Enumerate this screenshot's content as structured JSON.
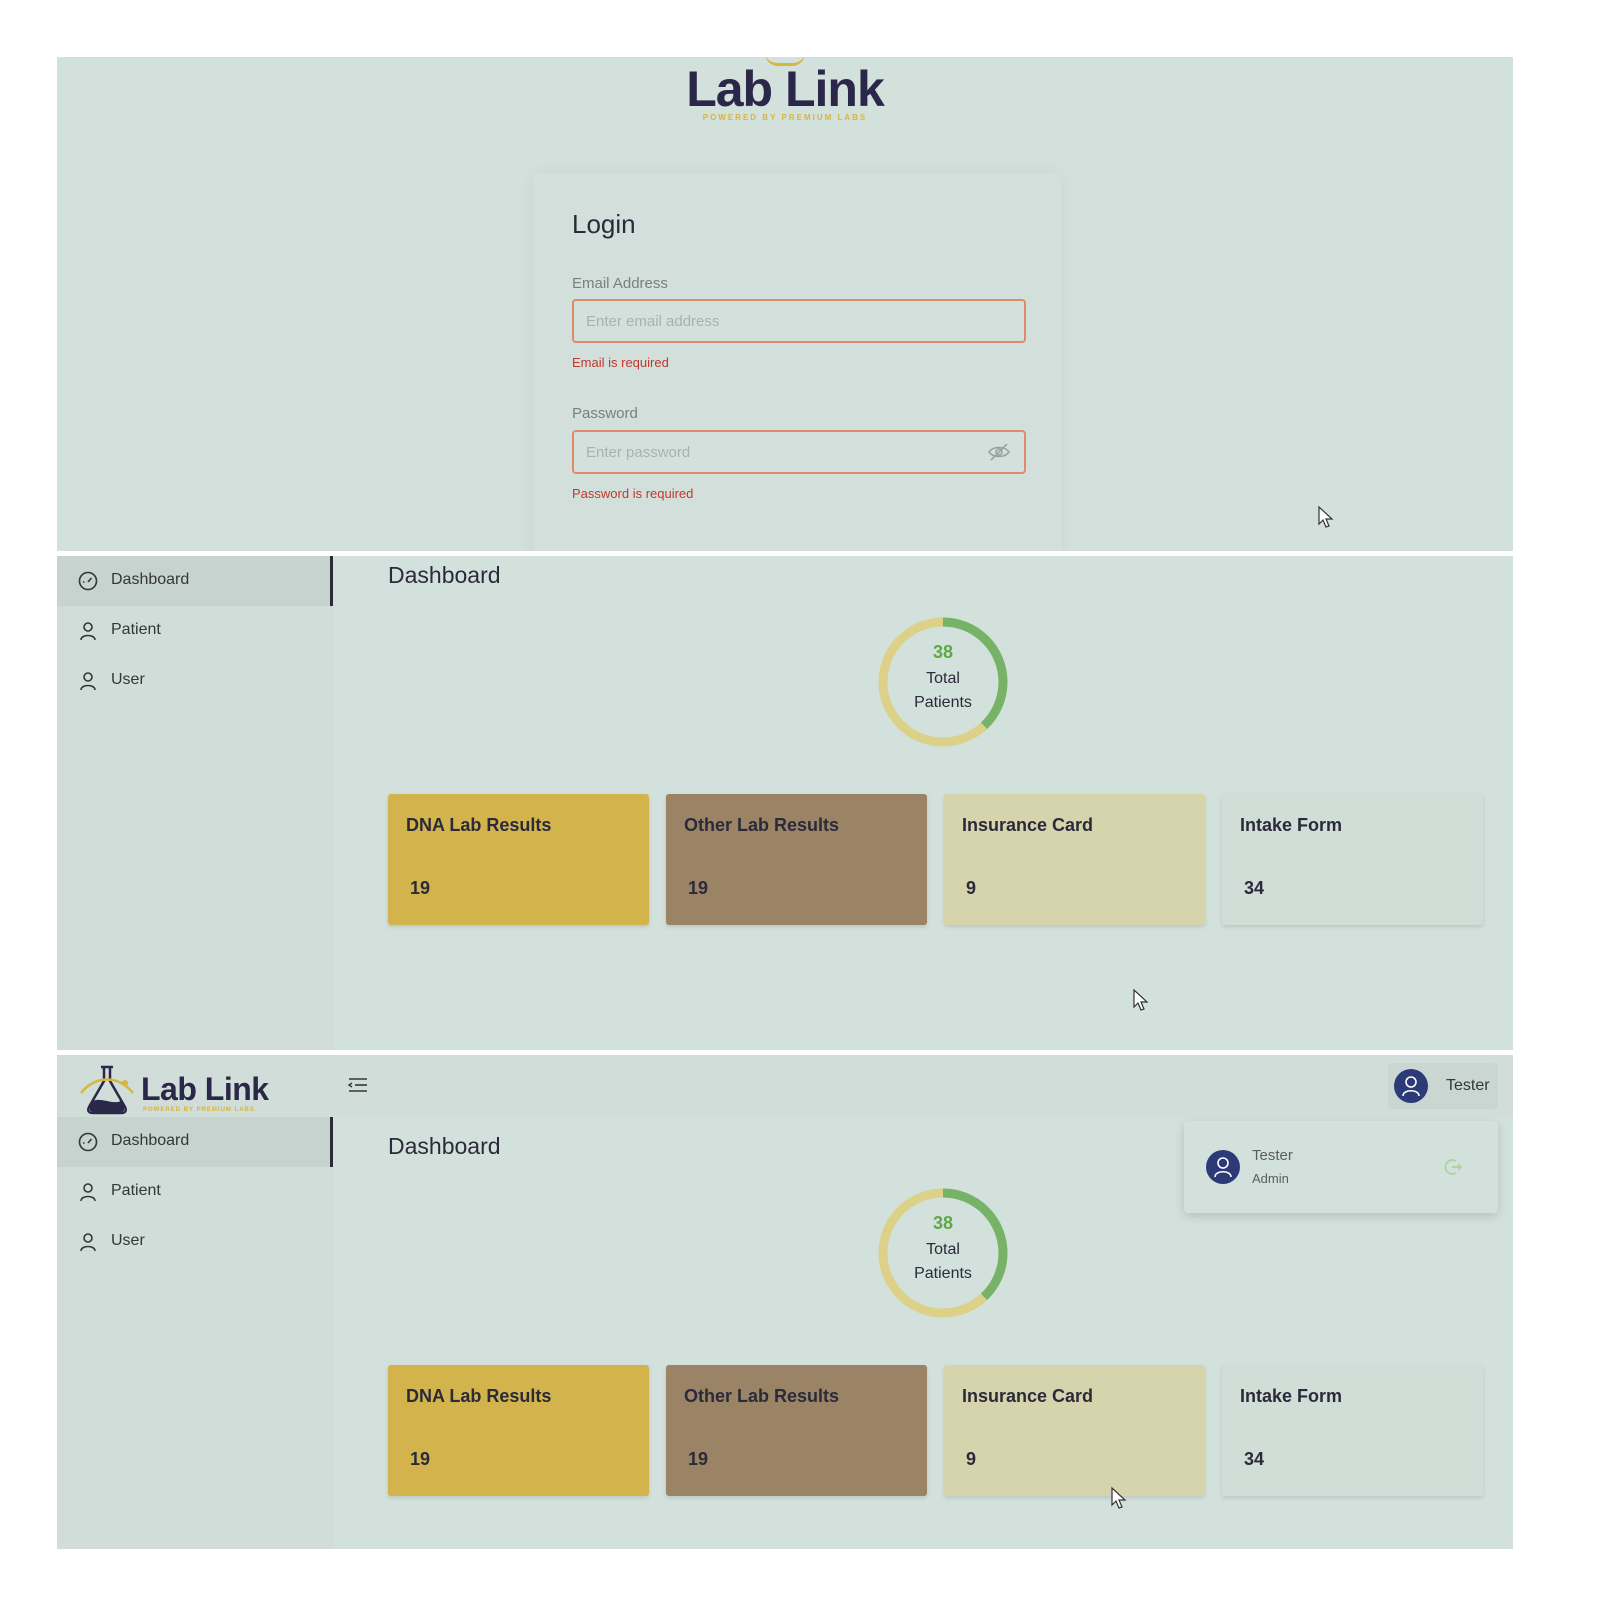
{
  "brand": {
    "name": "Lab Link",
    "tagline": "POWERED BY PREMIUM LABS"
  },
  "login": {
    "title": "Login",
    "email_label": "Email Address",
    "email_placeholder": "Enter email address",
    "email_error": "Email is required",
    "password_label": "Password",
    "password_placeholder": "Enter password",
    "password_error": "Password is required"
  },
  "sidebar": {
    "items": [
      {
        "label": "Dashboard",
        "icon": "dashboard-gauge-icon",
        "active": true
      },
      {
        "label": "Patient",
        "icon": "user-icon",
        "active": false
      },
      {
        "label": "User",
        "icon": "user-icon",
        "active": false
      }
    ]
  },
  "dashboard": {
    "title": "Dashboard",
    "total_patients": {
      "value": "38",
      "label_line1": "Total",
      "label_line2": "Patients",
      "fraction_green": 0.38
    },
    "cards": [
      {
        "title": "DNA Lab Results",
        "value": "19",
        "color": "#d3b44c"
      },
      {
        "title": "Other Lab Results",
        "value": "19",
        "color": "#9b8466"
      },
      {
        "title": "Insurance Card",
        "value": "9",
        "color": "#d6d4ac"
      },
      {
        "title": "Intake Form",
        "value": "34",
        "color": "#d1ddd7"
      }
    ]
  },
  "header": {
    "user_name": "Tester",
    "dropdown": {
      "name": "Tester",
      "role": "Admin"
    }
  },
  "colors": {
    "background": "#d3e1dc",
    "brand_dark": "#2a2748",
    "brand_gold": "#d8b53d",
    "error": "#c0392b",
    "donut_green": "#76b268",
    "donut_gold": "#ddd089",
    "avatar": "#2d3a78"
  }
}
